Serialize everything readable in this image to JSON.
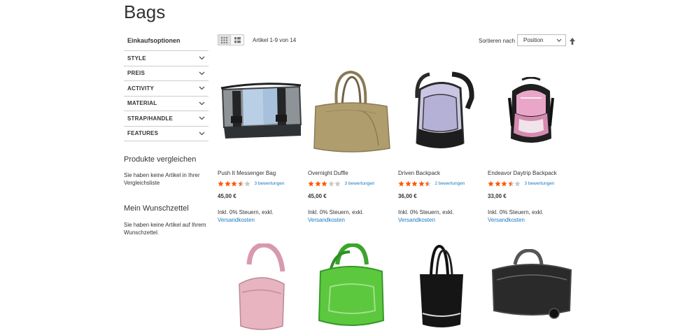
{
  "page": {
    "title": "Bags"
  },
  "sidebar": {
    "shopping_options_title": "Einkaufsoptionen",
    "filters": [
      "STYLE",
      "PREIS",
      "ACTIVITY",
      "MATERIAL",
      "STRAP/HANDLE",
      "FEATURES"
    ],
    "compare": {
      "title": "Produkte vergleichen",
      "text": "Sie haben keine Artikel in Ihrer Vergleichsliste"
    },
    "wishlist": {
      "title": "Mein Wunschzettel",
      "text": "Sie haben keine Artikel auf Ihrem Wunschzettel."
    }
  },
  "toolbar": {
    "amount": "Artikel 1-9 von 14",
    "sort_label": "Sortieren nach",
    "sort_value": "Position"
  },
  "products": [
    {
      "name": "Push It Messenger Bag",
      "rating": 3.5,
      "reviews": "3 bewertungen",
      "price": "45,00 €",
      "tax": "Inkl. 0% Steuern, exkl.",
      "shipping": "Versandkosten"
    },
    {
      "name": "Overnight Duffle",
      "rating": 3,
      "reviews": "3 bewertungen",
      "price": "45,00 €",
      "tax": "Inkl. 0% Steuern, exkl.",
      "shipping": "Versandkosten"
    },
    {
      "name": "Driven Backpack",
      "rating": 4.5,
      "reviews": "2 bewertungen",
      "price": "36,00 €",
      "tax": "Inkl. 0% Steuern, exkl.",
      "shipping": "Versandkosten"
    },
    {
      "name": "Endeavor Daytrip Backpack",
      "rating": 3.5,
      "reviews": "3 bewertungen",
      "price": "33,00 €",
      "tax": "Inkl. 0% Steuern, exkl.",
      "shipping": "Versandkosten"
    }
  ],
  "colors": {
    "star": "#ff5501",
    "star_empty": "#c7c7c7",
    "link": "#1979c3"
  },
  "icons": {
    "grid": "grid-view-icon",
    "list": "list-view-icon",
    "sort_dir": "arrow-up-icon",
    "filter": "chevron-down-icon"
  }
}
